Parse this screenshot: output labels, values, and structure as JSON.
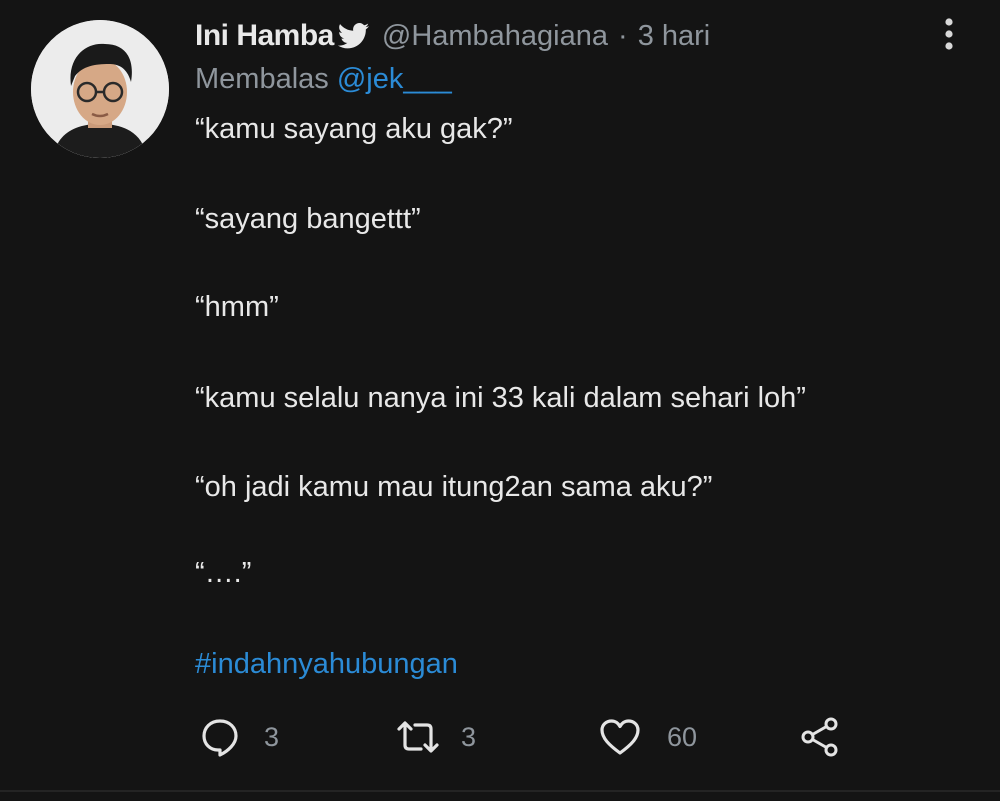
{
  "author": {
    "name": "Ini Hamba",
    "handle": "@Hambahagiana",
    "separator": "·",
    "time": "3 hari"
  },
  "reply": {
    "prefix": "Membalas",
    "mention": "@jek___"
  },
  "body_lines": [
    "“kamu sayang aku gak?”",
    "“sayang bangettt”",
    "“hmm”",
    "“kamu selalu nanya ini 33 kali dalam sehari loh”",
    "“oh jadi kamu mau itung2an sama aku?”",
    "“….”"
  ],
  "hashtag": "#indahnyahubungan",
  "actions": {
    "reply_count": "3",
    "retweet_count": "3",
    "like_count": "60"
  },
  "icons": {
    "verified": "bird-icon",
    "more": "more-vertical-icon",
    "reply": "reply-icon",
    "retweet": "retweet-icon",
    "like": "heart-icon",
    "share": "share-icon"
  },
  "colors": {
    "background": "#141414",
    "text": "#e8e8e8",
    "muted": "#8f969d",
    "link": "#2b8bd6"
  }
}
